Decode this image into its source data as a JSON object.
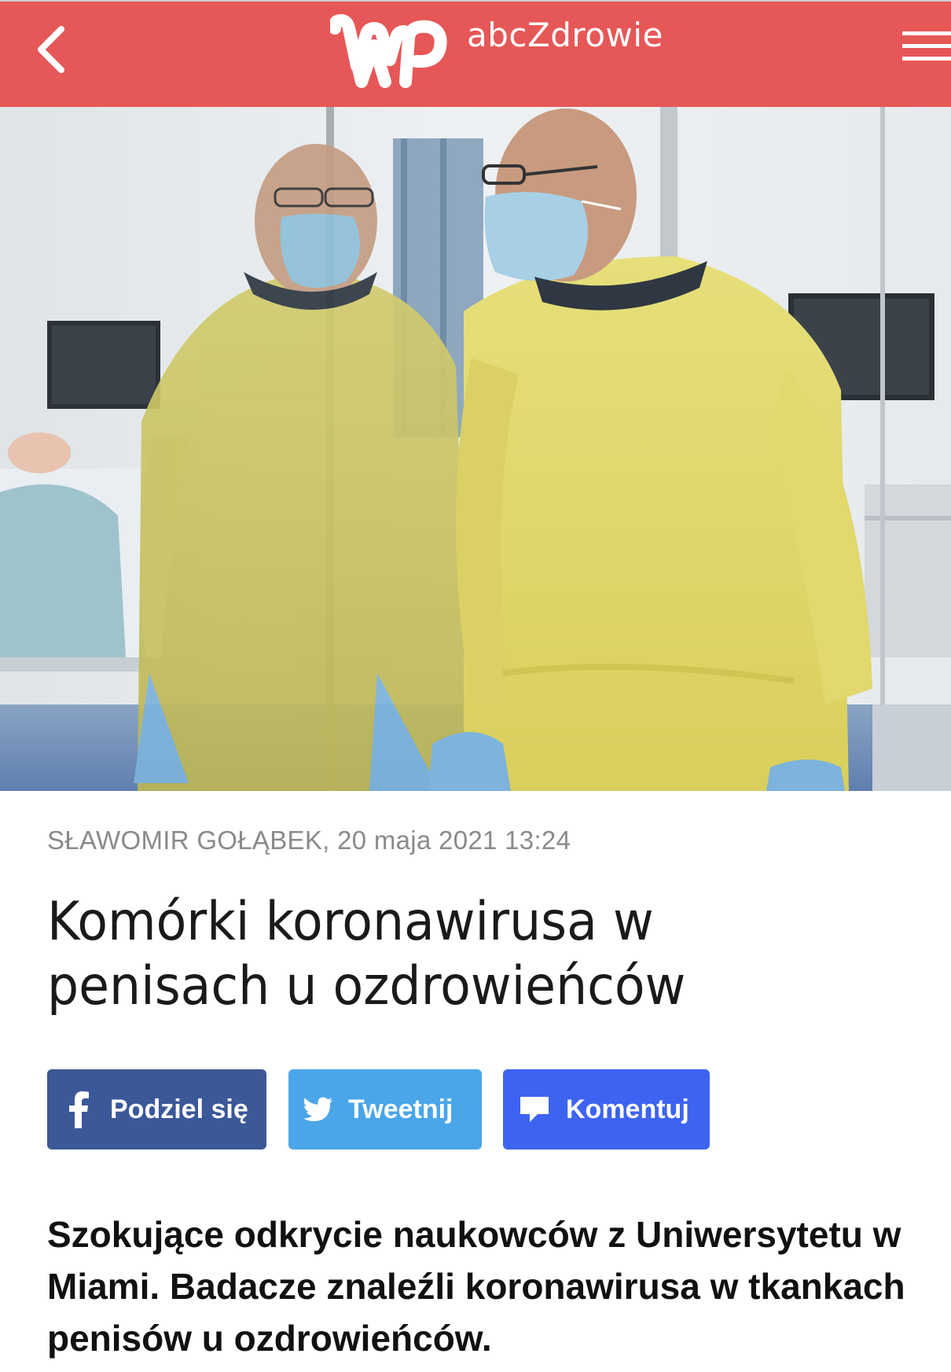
{
  "header": {
    "back_icon": "chevron-left-icon",
    "logo_text": "abcZdrowie",
    "menu_icon": "hamburger-menu-icon",
    "background_color": "#e65757"
  },
  "article": {
    "meta": "SŁAWOMIR GOŁĄBEK, 20 maja 2021 13:24",
    "title": "Komórki koronawirusa w penisach u ozdrowieńców",
    "lead": "Szokujące odkrycie naukowców z Uniwersytetu w Miami. Badacze znaleźli koronawirusa w tkankach penisów u ozdrowieńców."
  },
  "share": {
    "facebook_label": "Podziel się",
    "twitter_label": "Tweetnij",
    "comment_label": "Komentuj",
    "facebook_color": "#3b5898",
    "twitter_color": "#4aa6e8",
    "comment_color": "#3d63f0"
  }
}
